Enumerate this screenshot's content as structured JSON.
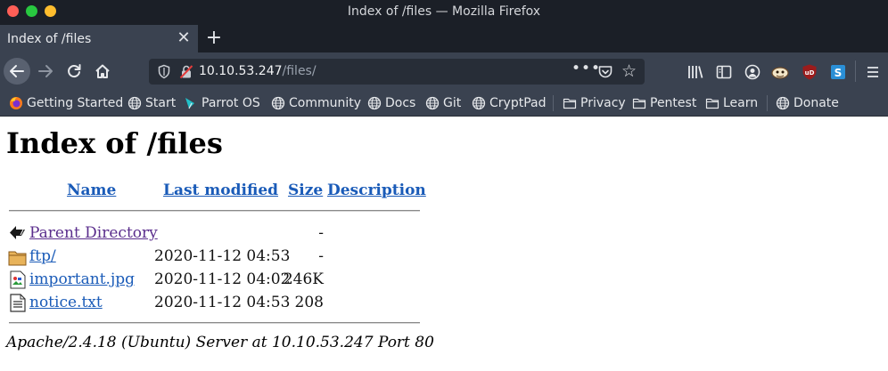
{
  "window": {
    "title": "Index of /files — Mozilla Firefox"
  },
  "tabs": [
    {
      "label": "Index of /files",
      "active": true
    }
  ],
  "urlbar": {
    "host": "10.10.53.247",
    "path": "/files/"
  },
  "bookmarks": [
    {
      "label": "Getting Started",
      "icon": "firefox-icon"
    },
    {
      "label": "Start",
      "icon": "globe-icon"
    },
    {
      "label": "Parrot OS",
      "icon": "parrot-icon"
    },
    {
      "label": "Community",
      "icon": "globe-icon"
    },
    {
      "label": "Docs",
      "icon": "globe-icon"
    },
    {
      "label": "Git",
      "icon": "globe-icon"
    },
    {
      "label": "CryptPad",
      "icon": "globe-icon"
    },
    {
      "label": "Privacy",
      "icon": "folder-icon"
    },
    {
      "label": "Pentest",
      "icon": "folder-icon"
    },
    {
      "label": "Learn",
      "icon": "folder-icon"
    },
    {
      "label": "Donate",
      "icon": "globe-icon"
    }
  ],
  "page": {
    "heading": "Index of /files",
    "columns": {
      "name": "Name",
      "last_modified": "Last modified",
      "size": "Size",
      "description": "Description"
    },
    "rows": [
      {
        "name": "Parent Directory",
        "modified": "",
        "size": "-",
        "icon": "back-arrow-icon"
      },
      {
        "name": "ftp/",
        "modified": "2020-11-12 04:53",
        "size": "-",
        "icon": "folder-icon"
      },
      {
        "name": "important.jpg",
        "modified": "2020-11-12 04:02",
        "size": "246K",
        "icon": "image-file-icon"
      },
      {
        "name": "notice.txt",
        "modified": "2020-11-12 04:53",
        "size": "208",
        "icon": "text-file-icon"
      }
    ],
    "footer": "Apache/2.4.18 (Ubuntu) Server at 10.10.53.247 Port 80"
  },
  "colors": {
    "chrome_dark": "#1b1f27",
    "toolbar": "#3a4250",
    "urlbar": "#272d37",
    "link": "#1a5bb8",
    "visited_link": "#5a2d8c"
  }
}
